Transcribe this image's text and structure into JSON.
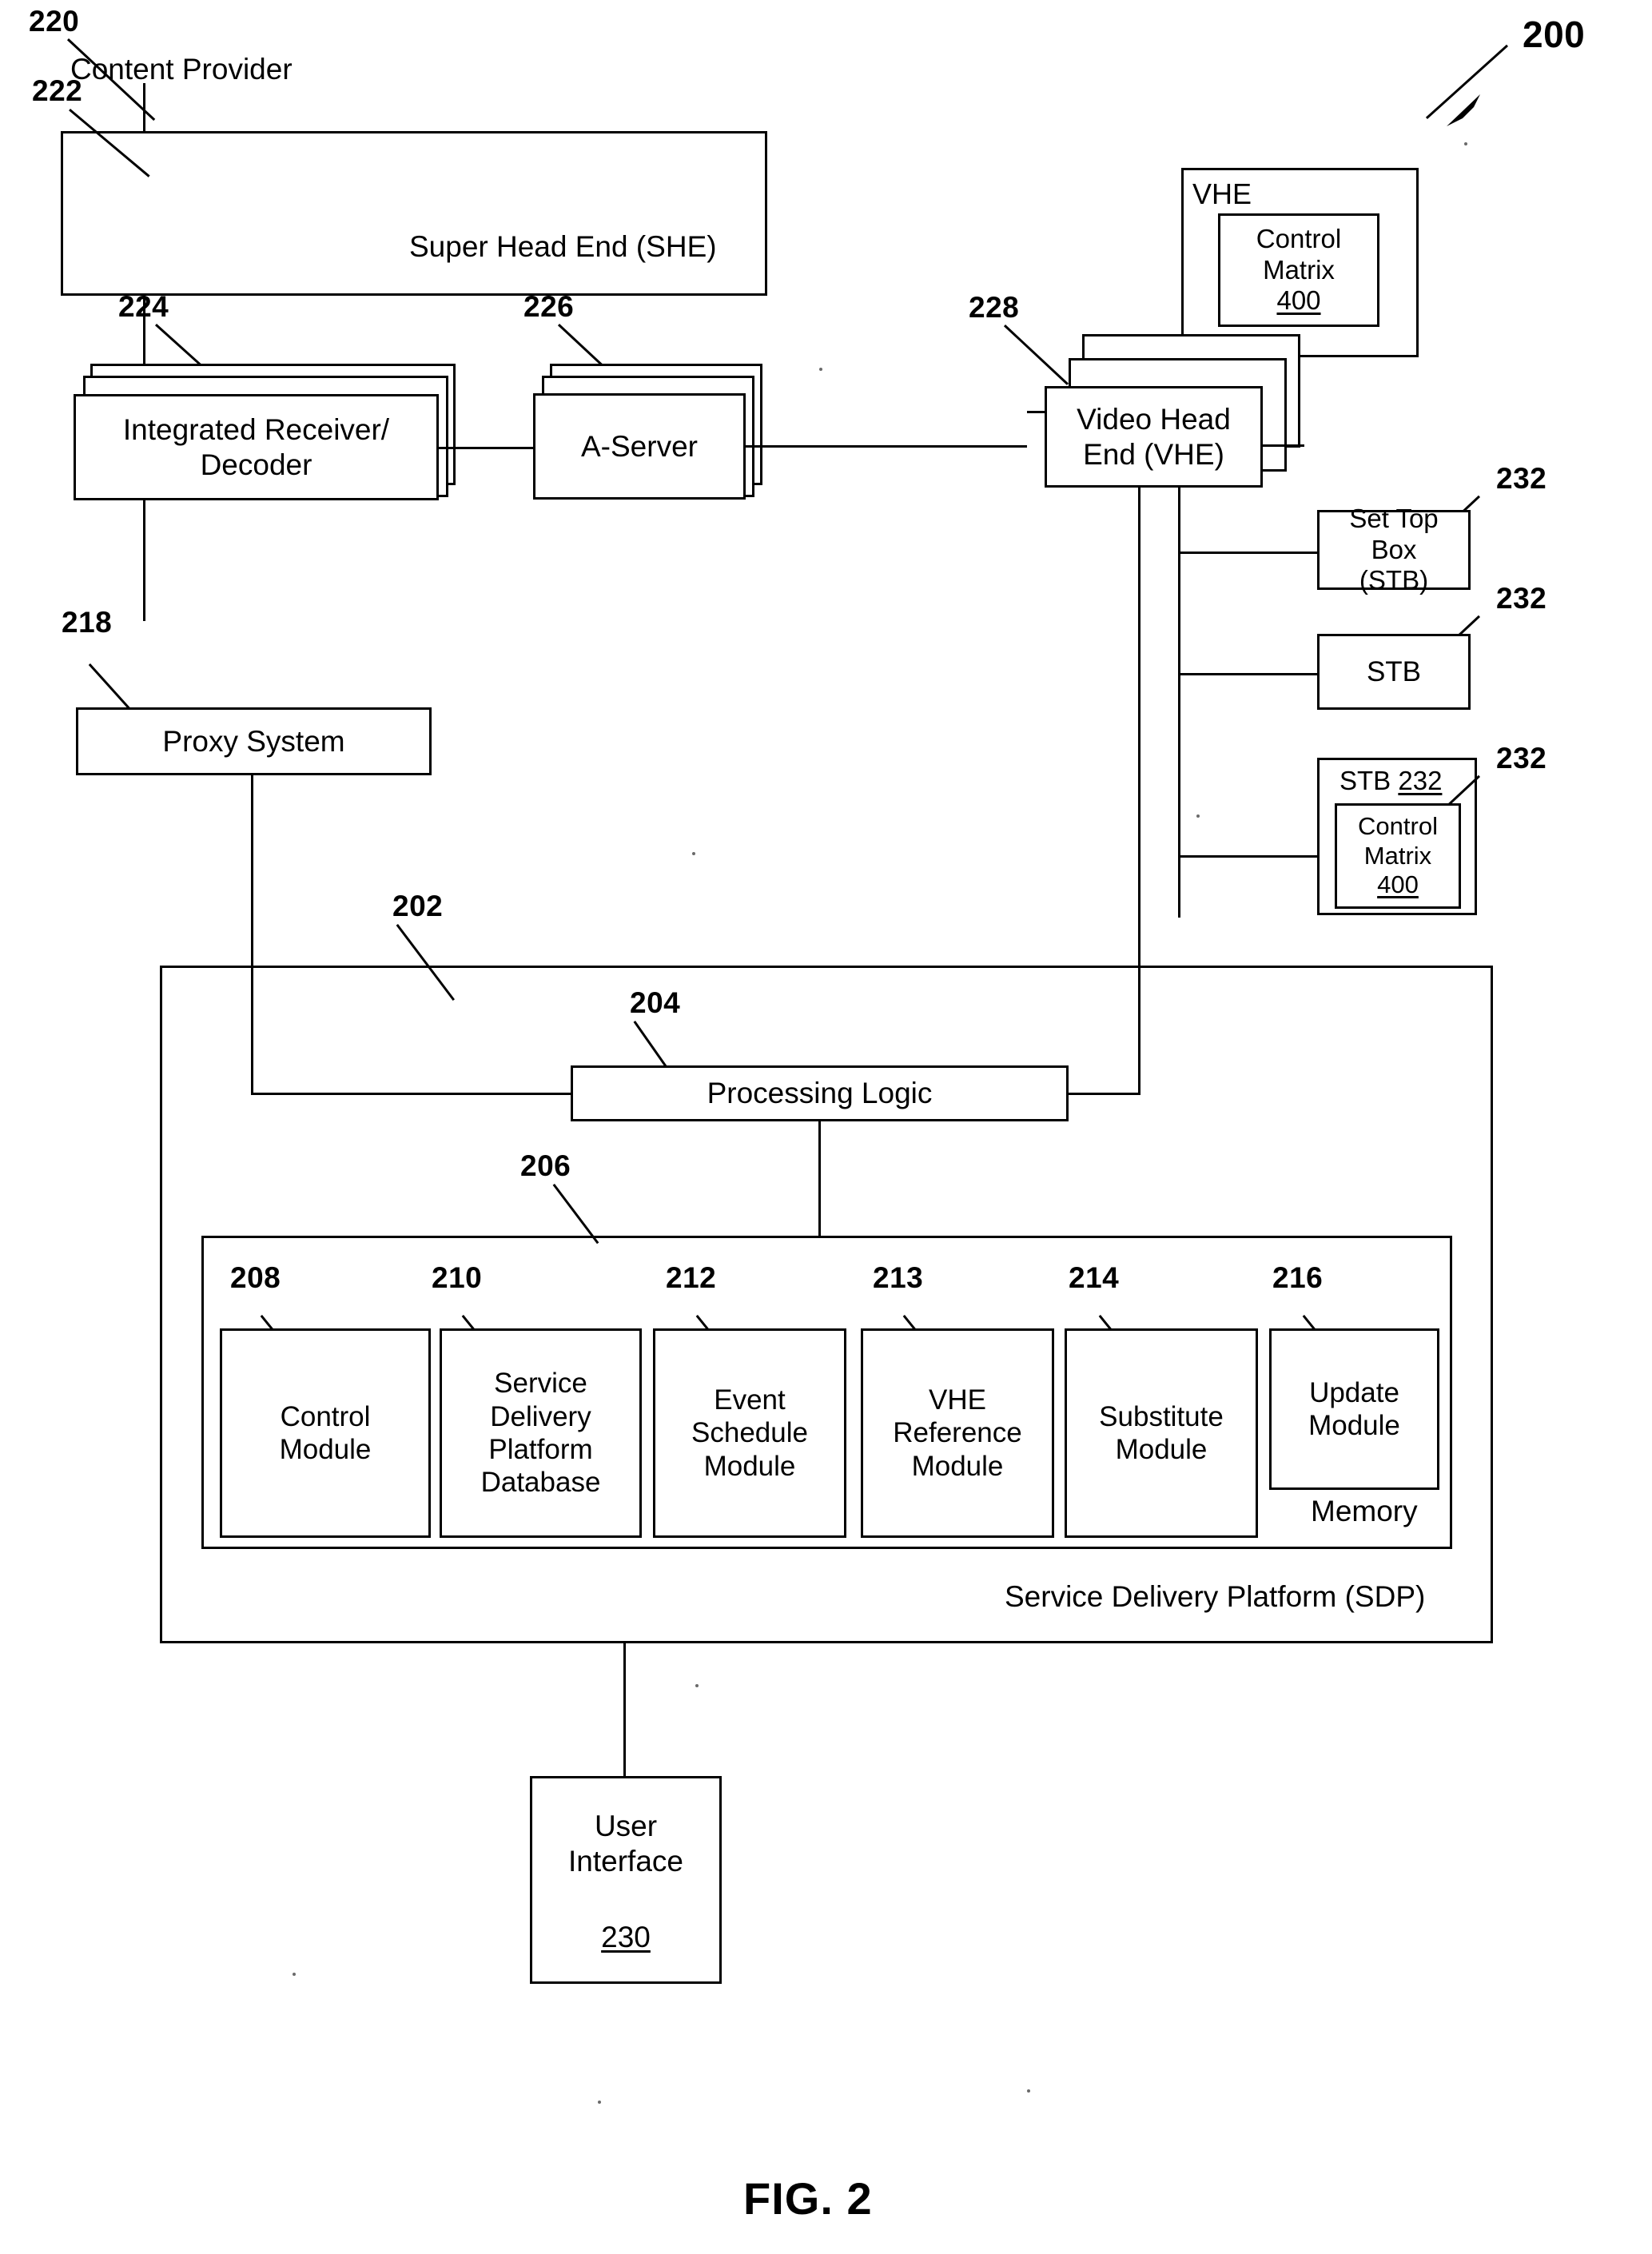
{
  "figure": {
    "caption": "FIG. 2",
    "system_ref": "200"
  },
  "refs": {
    "content_provider": "220",
    "super_head_end": "222",
    "integrated_receiver_decoder": "224",
    "a_server": "226",
    "video_head_end": "228",
    "stb_1": "232",
    "stb_2": "232",
    "stb_3": "232",
    "proxy_system": "218",
    "sdp": "202",
    "processing_logic": "204",
    "memory": "206",
    "control_module": "208",
    "sdp_database": "210",
    "event_schedule_module": "212",
    "vhe_reference_module": "213",
    "substitute_module": "214",
    "update_module": "216"
  },
  "nodes": {
    "content_provider": {
      "label": "Content Provider"
    },
    "super_head_end": {
      "label": "Super Head End (SHE)"
    },
    "integrated_receiver_decoder": {
      "label_line1": "Integrated Receiver/",
      "label_line2": "Decoder"
    },
    "a_server": {
      "label": "A-Server"
    },
    "video_head_end": {
      "label_line1": "Video Head",
      "label_line2": "End (VHE)"
    },
    "vhe_panel": {
      "label": "VHE"
    },
    "vhe_control_matrix": {
      "line1": "Control",
      "line2": "Matrix",
      "ref": "400"
    },
    "stb_1": {
      "line1": "Set Top Box",
      "line2": "(STB)"
    },
    "stb_2": {
      "label": "STB"
    },
    "stb_3": {
      "label": "STB",
      "ref": "232"
    },
    "stb_control_matrix": {
      "line1": "Control",
      "line2": "Matrix",
      "ref": "400"
    },
    "proxy_system": {
      "label": "Proxy System"
    },
    "processing_logic": {
      "label": "Processing Logic"
    },
    "memory": {
      "label": "Memory"
    },
    "sdp": {
      "label": "Service Delivery Platform (SDP)"
    },
    "user_interface": {
      "line1": "User",
      "line2": "Interface",
      "ref": "230"
    }
  },
  "memory_modules": [
    {
      "ref": "208",
      "lines": [
        "Control",
        "Module"
      ]
    },
    {
      "ref": "210",
      "lines": [
        "Service",
        "Delivery",
        "Platform",
        "Database"
      ]
    },
    {
      "ref": "212",
      "lines": [
        "Event",
        "Schedule",
        "Module"
      ]
    },
    {
      "ref": "213",
      "lines": [
        "VHE",
        "Reference",
        "Module"
      ]
    },
    {
      "ref": "214",
      "lines": [
        "Substitute",
        "Module"
      ]
    },
    {
      "ref": "216",
      "lines": [
        "Update",
        "Module"
      ]
    }
  ],
  "colors": {
    "ink": "#000000",
    "paper": "#ffffff"
  }
}
